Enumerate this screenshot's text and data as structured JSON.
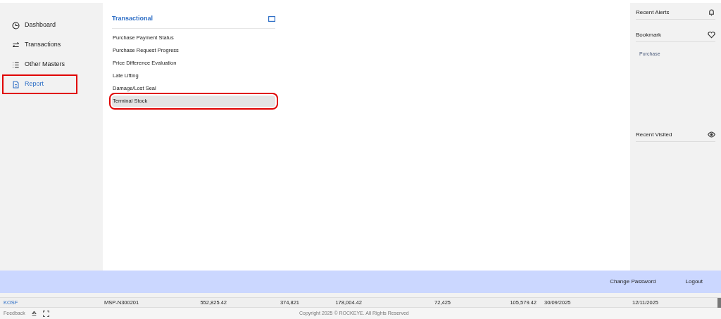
{
  "sidebar": {
    "items": [
      {
        "label": "Dashboard",
        "selected": false,
        "highlighted": false
      },
      {
        "label": "Transactions",
        "selected": false,
        "highlighted": false
      },
      {
        "label": "Other Masters",
        "selected": false,
        "highlighted": false
      },
      {
        "label": "Report",
        "selected": true,
        "highlighted": true
      }
    ]
  },
  "menu": {
    "title": "Transactional",
    "items": [
      {
        "label": "Purchase Payment Status",
        "selected": false,
        "highlighted": false
      },
      {
        "label": "Purchase Request Progress",
        "selected": false,
        "highlighted": false
      },
      {
        "label": "Price Difference Evaluation",
        "selected": false,
        "highlighted": false
      },
      {
        "label": "Late Lifting",
        "selected": false,
        "highlighted": false
      },
      {
        "label": "Damage/Lost Seal",
        "selected": false,
        "highlighted": false
      },
      {
        "label": "Terminal Stock",
        "selected": true,
        "highlighted": true
      }
    ]
  },
  "right_panel": {
    "sections": [
      {
        "title": "Recent Alerts"
      },
      {
        "title": "Bookmark",
        "items": [
          "Purchase"
        ]
      },
      {
        "title": "Recent Visited"
      }
    ]
  },
  "action_bar": {
    "links": [
      "Change Password",
      "Logout"
    ]
  },
  "table": {
    "rows": [
      [
        "KOSF",
        "MSP-N300201",
        "552,825.42",
        "374,821",
        "178,004.42",
        "72,425",
        "105,579.42",
        "30/09/2025",
        "12/11/2025"
      ]
    ]
  },
  "footer": {
    "feedback": "Feedback",
    "copyright": "Copyright 2025 © ROCKEYE. All Rights Reserved"
  }
}
